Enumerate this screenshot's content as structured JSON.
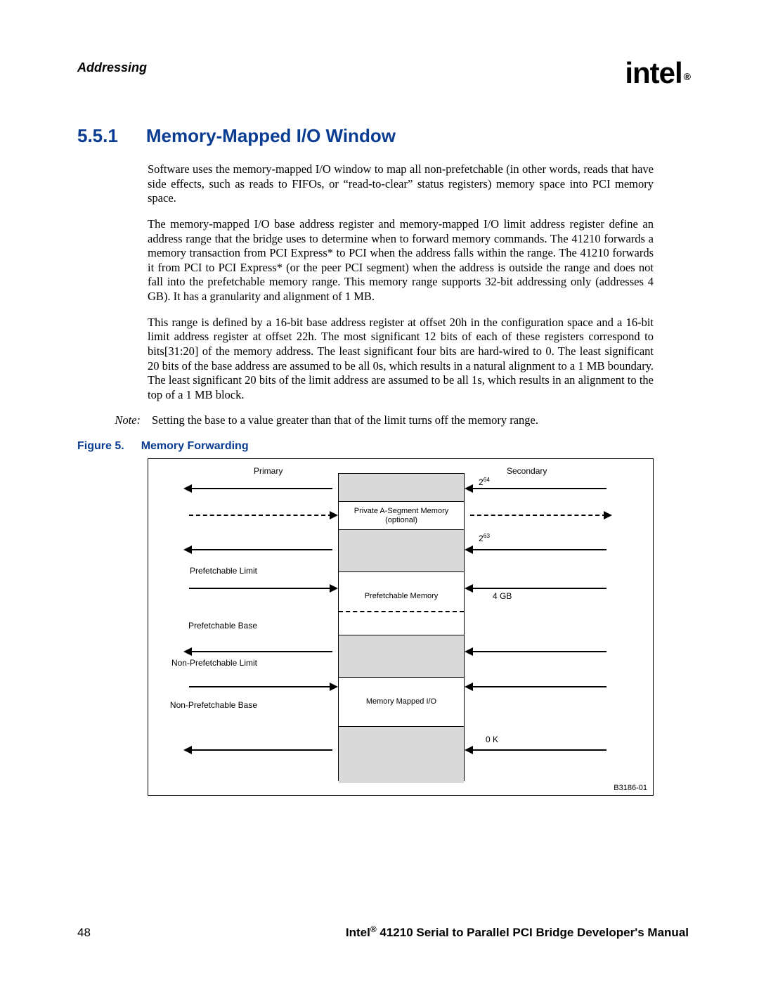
{
  "header": {
    "chapter": "Addressing",
    "logo_text": "intel",
    "logo_reg": "®"
  },
  "section": {
    "number": "5.5.1",
    "title": "Memory-Mapped I/O Window"
  },
  "paragraphs": {
    "p1": "Software uses the memory-mapped I/O window to map all non-prefetchable (in other words, reads that have side effects, such as reads to FIFOs, or “read-to-clear” status registers) memory space into PCI memory space.",
    "p2": "The memory-mapped I/O base address register and memory-mapped I/O limit address register define an address range that the bridge uses to determine when to forward memory commands. The 41210 forwards a memory transaction from PCI Express* to PCI when the address falls within the range. The 41210 forwards it from PCI to PCI Express* (or the peer PCI segment) when the address is outside the range and does not fall into the prefetchable memory range. This memory range supports 32-bit addressing only (addresses 4 GB). It has a granularity and alignment of 1 MB.",
    "p3": "This range is defined by a 16-bit base address register at offset 20h in the configuration space and a 16-bit limit address register at offset 22h. The most significant 12 bits of each of these registers correspond to bits[31:20] of the memory address. The least significant four bits are hard-wired to 0. The least significant 20 bits of the base address are assumed to be all 0s, which results in a natural alignment to a 1 MB boundary. The least significant 20 bits of the limit address are assumed to be all 1s, which results in an alignment to the top of a 1 MB block."
  },
  "note": {
    "label": "Note:",
    "text": "Setting the base to a value greater than that of the limit turns off the memory range."
  },
  "figure": {
    "label": "Figure 5.",
    "title": "Memory Forwarding",
    "primary": "Primary",
    "secondary": "Secondary",
    "private_a": "Private A-Segment Memory",
    "optional": "(optional)",
    "prefetch_limit": "Prefetchable Limit",
    "prefetch_mem": "Prefetchable Memory",
    "prefetch_base": "Prefetchable Base",
    "nonpre_limit": "Non-Prefetchable Limit",
    "mmio": "Memory Mapped I/O",
    "nonpre_base": "Non-Prefetchable Base",
    "two64_base": "2",
    "two64_exp": "64",
    "two63_base": "2",
    "two63_exp": "63",
    "four_gb": "4 GB",
    "zero_k": "0 K",
    "code": "B3186-01"
  },
  "footer": {
    "page": "48",
    "brand": "Intel",
    "reg": "®",
    "title_rest": " 41210 Serial to Parallel PCI Bridge Developer's Manual"
  }
}
